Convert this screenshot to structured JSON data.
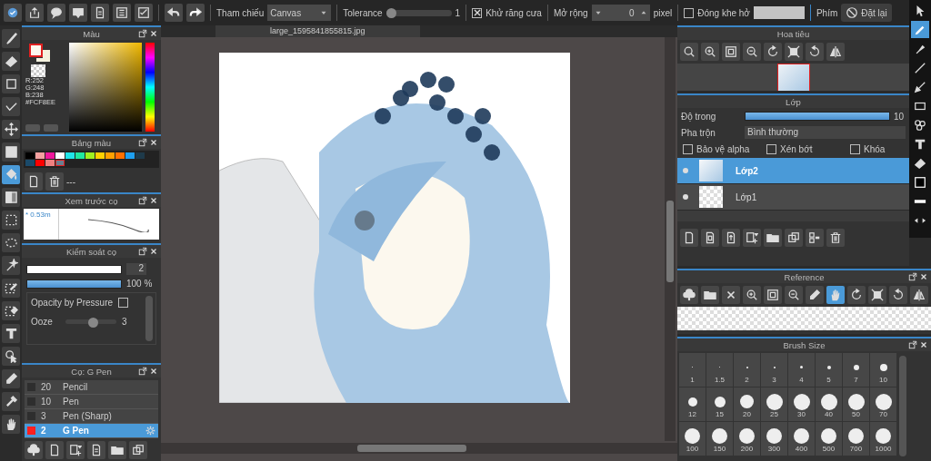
{
  "toolbar": {
    "reference_label": "Tham chiếu",
    "reference_value": "Canvas",
    "tolerance": {
      "label": "Tolerance",
      "level": 0,
      "value": "1"
    },
    "antialias": {
      "label": "Khử răng cưa",
      "checked": true
    },
    "expand_label": "Mở rộng",
    "expand_value": "0",
    "expand_unit": "pixel",
    "close_gap": {
      "label": "Đóng khe hở",
      "checked": false
    },
    "keys_label": "Phím",
    "reset_button": "Đặt lại"
  },
  "left_tools": [
    {
      "kind": "brush",
      "selected": false
    },
    {
      "kind": "eraser",
      "selected": false
    },
    {
      "kind": "square",
      "selected": false
    },
    {
      "kind": "polyline",
      "selected": false
    },
    {
      "kind": "move",
      "selected": false
    },
    {
      "kind": "fill",
      "selected": false
    },
    {
      "kind": "bucket",
      "selected": true
    },
    {
      "kind": "gradient",
      "selected": false
    },
    {
      "kind": "select",
      "selected": false
    },
    {
      "kind": "lasso",
      "selected": false
    },
    {
      "kind": "wand",
      "selected": false
    },
    {
      "kind": "selpen",
      "selected": false
    },
    {
      "kind": "selerase",
      "selected": false
    },
    {
      "kind": "text",
      "selected": false
    },
    {
      "kind": "operate",
      "selected": false
    },
    {
      "kind": "smudge",
      "selected": false
    },
    {
      "kind": "dropper",
      "selected": false
    },
    {
      "kind": "hand",
      "selected": false
    }
  ],
  "right_tools": [
    {
      "kind": "cursor",
      "selected": false
    },
    {
      "kind": "pencil",
      "selected": true
    },
    {
      "kind": "marker",
      "selected": false
    },
    {
      "kind": "line",
      "selected": false
    },
    {
      "kind": "arrowpen",
      "selected": false
    },
    {
      "kind": "rect",
      "selected": false
    },
    {
      "kind": "circles",
      "selected": false
    },
    {
      "kind": "text",
      "selected": false
    },
    {
      "kind": "eraser",
      "selected": false
    },
    {
      "kind": "color",
      "selected": false
    },
    {
      "kind": "thickness",
      "selected": false
    },
    {
      "kind": "swap",
      "selected": false
    }
  ],
  "color_panel": {
    "title": "Màu",
    "readout": [
      "R:252",
      "G:248",
      "B:238",
      "#FCF8EE"
    ]
  },
  "palette_panel": {
    "title": "Bảng màu",
    "swatches": [
      {
        "color": "#000000",
        "selected": false
      },
      {
        "color": "#f4a0a0",
        "selected": false
      },
      {
        "color": "#f0189c",
        "selected": false
      },
      {
        "color": "#ffffff",
        "selected": false
      },
      {
        "color": "#20e4e8",
        "selected": false
      },
      {
        "color": "#20e8a0",
        "selected": false
      },
      {
        "color": "#a0f020",
        "selected": false
      },
      {
        "color": "#ffd000",
        "selected": false
      },
      {
        "color": "#ffa000",
        "selected": false
      },
      {
        "color": "#ff7000",
        "selected": false
      },
      {
        "color": "#1ea0f0",
        "selected": false
      },
      {
        "color": "#1e3a4a",
        "selected": false
      },
      {
        "color": "#1a4a6a",
        "selected": false
      },
      {
        "color": "#ff0000",
        "selected": false
      },
      {
        "color": "#f08080",
        "selected": false
      },
      {
        "color": "#6a7f90",
        "selected": true
      }
    ],
    "name": "---"
  },
  "preview_panel": {
    "title": "Xem trước cọ",
    "size": "* 0.53m"
  },
  "brush_control": {
    "title": "Kiểm soát cọ",
    "size": {
      "level": 1,
      "value": "2"
    },
    "opacity": {
      "level": 1,
      "value": "100 %"
    },
    "opacity_by_pressure": {
      "label": "Opacity by Pressure",
      "checked": false
    },
    "ooze": {
      "label": "Ooze",
      "level": 0.55,
      "value": "3"
    }
  },
  "brush_list": {
    "title": "Cọ: G Pen",
    "items": [
      {
        "color": "#2e2e2e",
        "size": "20",
        "name": "Pencil",
        "selected": false
      },
      {
        "color": "#2e2e2e",
        "size": "10",
        "name": "Pen",
        "selected": false
      },
      {
        "color": "#2e2e2e",
        "size": "3",
        "name": "Pen (Sharp)",
        "selected": false
      },
      {
        "color": "#ff2020",
        "size": "2",
        "name": "G Pen",
        "selected": true
      }
    ]
  },
  "canvas": {
    "tab": "large_1595841855815.jpg"
  },
  "navigator": {
    "title": "Hoa tiêu"
  },
  "layers": {
    "title": "Lớp",
    "opacity_label": "Độ trong",
    "opacity": {
      "level": 1,
      "value": "10"
    },
    "blend_label": "Pha trộn",
    "blend_value": "Bình thường",
    "options": [
      {
        "label": "Bảo vệ alpha",
        "checked": false
      },
      {
        "label": "Xén bớt",
        "checked": false
      },
      {
        "label": "Khóa",
        "checked": false
      }
    ],
    "items": [
      {
        "name": "Lớp2",
        "kind": "artwork",
        "visible": true,
        "selected": true
      },
      {
        "name": "Lớp1",
        "kind": "empty",
        "visible": true,
        "selected": false
      }
    ]
  },
  "reference": {
    "title": "Reference",
    "tools": [
      {
        "kind": "cloudup",
        "selected": false
      },
      {
        "kind": "folder",
        "selected": false
      },
      {
        "kind": "x",
        "selected": false
      },
      {
        "kind": "zoomin",
        "selected": false
      },
      {
        "kind": "fit",
        "selected": false
      },
      {
        "kind": "zoomout",
        "selected": false
      },
      {
        "kind": "smudge",
        "selected": false
      },
      {
        "kind": "hand",
        "selected": true
      },
      {
        "kind": "rotl",
        "selected": false
      },
      {
        "kind": "full",
        "selected": false
      },
      {
        "kind": "rotr",
        "selected": false
      },
      {
        "kind": "flip",
        "selected": false
      }
    ]
  },
  "brush_size": {
    "title": "Brush Size",
    "sizes": [
      "1",
      "1.5",
      "2",
      "3",
      "4",
      "5",
      "7",
      "10",
      "12",
      "15",
      "20",
      "25",
      "30",
      "40",
      "50",
      "70",
      "100",
      "150",
      "200",
      "300",
      "400",
      "500",
      "700",
      "1000"
    ]
  }
}
